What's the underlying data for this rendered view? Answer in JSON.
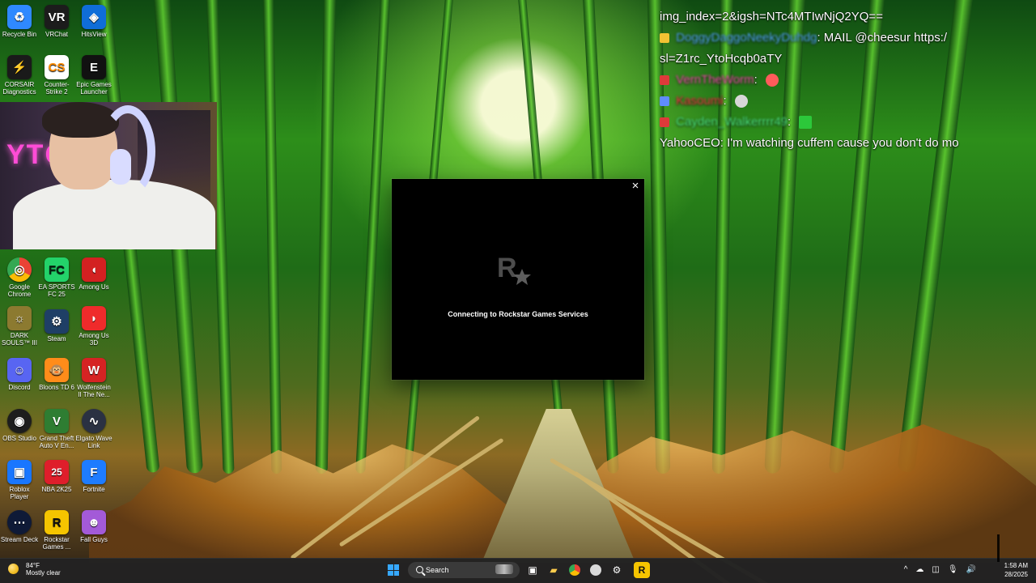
{
  "desktop_icons": [
    {
      "label": "Recycle Bin",
      "icon": "recycle-bin-icon",
      "color": "#2f89ff"
    },
    {
      "label": "VRChat",
      "icon": "vrchat-icon",
      "color": "#1c1c1c"
    },
    {
      "label": "HitsView",
      "icon": "hitsview-icon",
      "color": "#0f6dd8"
    },
    {
      "label": "CORSAIR Diagnostics",
      "icon": "corsair-icon",
      "color": "#1a1a1a"
    },
    {
      "label": "Counter-Strike 2",
      "icon": "counter-strike-icon",
      "color": "#ffffff"
    },
    {
      "label": "Epic Games Launcher",
      "icon": "epic-games-icon",
      "color": "#111111"
    },
    {
      "label": "Google Chrome",
      "icon": "chrome-icon",
      "color": "#ffffff"
    },
    {
      "label": "EA SPORTS FC 25",
      "icon": "ea-sports-fc-icon",
      "color": "#23d36a"
    },
    {
      "label": "Among Us",
      "icon": "among-us-icon",
      "color": "#d32121"
    },
    {
      "label": "DARK SOULS™ III",
      "icon": "dark-souls-icon",
      "color": "#8c7a30"
    },
    {
      "label": "Steam",
      "icon": "steam-icon",
      "color": "#1f3f66"
    },
    {
      "label": "Among Us 3D",
      "icon": "among-us-3d-icon",
      "color": "#ef2b2b"
    },
    {
      "label": "Discord",
      "icon": "discord-icon",
      "color": "#5865f2"
    },
    {
      "label": "Bloons TD 6",
      "icon": "bloons-icon",
      "color": "#ff8c1a"
    },
    {
      "label": "Wolfenstein II The Ne...",
      "icon": "wolfenstein-icon",
      "color": "#d52323"
    },
    {
      "label": "OBS Studio",
      "icon": "obs-icon",
      "color": "#1d1d1d"
    },
    {
      "label": "Grand Theft Auto V En...",
      "icon": "gta-icon",
      "color": "#2e7d32"
    },
    {
      "label": "Elgato Wave Link",
      "icon": "elgato-wave-link-icon",
      "color": "#2a3142"
    },
    {
      "label": "Roblox Player",
      "icon": "roblox-icon",
      "color": "#1976ff"
    },
    {
      "label": "NBA 2K25",
      "icon": "nba-2k25-icon",
      "color": "#df1e2b"
    },
    {
      "label": "Fortnite",
      "icon": "fortnite-icon",
      "color": "#1e7cff"
    },
    {
      "label": "Stream Deck",
      "icon": "stream-deck-icon",
      "color": "#0f1a37"
    },
    {
      "label": "Rockstar Games ...",
      "icon": "rockstar-games-icon",
      "color": "#f5c400"
    },
    {
      "label": "Fall Guys",
      "icon": "fall-guys-icon",
      "color": "#a35ad8"
    }
  ],
  "chat": {
    "lines": [
      {
        "prefix": "",
        "name": "",
        "message": "img_index=2&igsh=NTc4MTIwNjQ2YQ==",
        "name_class": ""
      },
      {
        "prefix": "gold",
        "name": "DoggyDaggoNeekyDuhdg",
        "message": "MAIL @cheesur https:/",
        "name_class": "blue-name"
      },
      {
        "prefix": "",
        "name": "",
        "message": "sl=Z1rc_YtoHcqb0aTY",
        "name_class": ""
      },
      {
        "prefix": "red",
        "name": "VernTheWorm",
        "message": "",
        "name_class": "pink-name",
        "emote": "heart"
      },
      {
        "prefix": "blue",
        "name": "Kasoumi",
        "message": "",
        "name_class": "red-name",
        "emote": "skull"
      },
      {
        "prefix": "red",
        "name": "Cayden_Walkerrrr49",
        "message": "",
        "name_class": "green-name",
        "emote": "grass"
      },
      {
        "prefix": "",
        "name": "YahooCEO",
        "message": "I'm watching cuffem cause you don't do mo",
        "name_class": ""
      }
    ]
  },
  "dialog": {
    "close_label": "×",
    "status_text": "Connecting to Rockstar Games Services",
    "logo_icon": "rockstar-logo-icon"
  },
  "taskbar": {
    "weather_temp": "84°F",
    "weather_desc": "Mostly clear",
    "search_label": "Search",
    "time": "1:58 AM",
    "date": "28/2025",
    "apps": [
      {
        "name": "task-view",
        "icon": "task-view-icon"
      },
      {
        "name": "file-explorer",
        "icon": "folder-icon"
      },
      {
        "name": "chrome",
        "icon": "chrome-icon"
      },
      {
        "name": "obs",
        "icon": "obs-icon"
      },
      {
        "name": "steam",
        "icon": "steam-icon"
      },
      {
        "name": "rockstar",
        "icon": "rockstar-games-icon"
      }
    ],
    "tray_icons": [
      {
        "name": "chevron-up-icon",
        "glyph": "^"
      },
      {
        "name": "cloud-icon",
        "glyph": "☁"
      },
      {
        "name": "network-icon",
        "glyph": "◫"
      },
      {
        "name": "microphone-icon",
        "glyph": "🎙"
      },
      {
        "name": "speaker-icon",
        "glyph": "🔊"
      }
    ]
  }
}
